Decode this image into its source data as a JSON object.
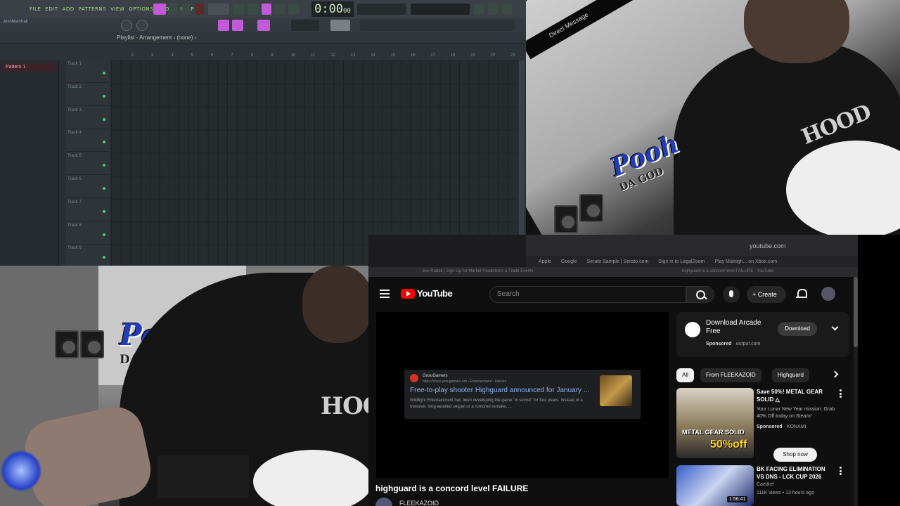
{
  "fl": {
    "menu": [
      "FILE",
      "EDIT",
      "ADD",
      "PATTERNS",
      "VIEW",
      "OPTIONS",
      "TOOLS",
      "HELP"
    ],
    "time": "0:00",
    "time_small": "00",
    "user": "JoshMarshall",
    "playlist_title": "Playlist - Arrangement › (none) ›",
    "pattern": "Pattern 1",
    "tracks": [
      "Track 1",
      "Track 2",
      "Track 3",
      "Track 4",
      "Track 5",
      "Track 6",
      "Track 7",
      "Track 8",
      "Track 9"
    ],
    "ruler": [
      "2",
      "3",
      "4",
      "5",
      "6",
      "7",
      "8",
      "9",
      "10",
      "11",
      "12",
      "13",
      "14",
      "15",
      "16",
      "17",
      "18",
      "19",
      "20",
      "21"
    ]
  },
  "cam_top": {
    "dm_label": "Direct Message",
    "logo": "Pooh",
    "logo_sub": "DA GOD",
    "hoodie_text": "HOOD"
  },
  "cam_bottom": {
    "logo": "Pooh",
    "logo_sub": "DA GOD",
    "hoodie_text": "HOOD"
  },
  "browser": {
    "url": "youtube.com",
    "bookmarks": [
      "Apple",
      "Google",
      "Serato Sample | Serato.com",
      "Sign in to LegalZoom",
      "Play Midnigh... on Xbox.com"
    ],
    "tabs": [
      "Jive Rabbit | Sign Up for Market Predictions & Trade Events",
      "highguard is a concord level FAILURE - YouTube"
    ]
  },
  "youtube": {
    "logo": "YouTube",
    "search_placeholder": "Search",
    "create_label": "+ Create",
    "card": {
      "source": "GosuGamers",
      "source_url": "https://www.gosugamers.net › Entertainment › Articles",
      "title": "Free-to-play shooter Highguard announced for January ...",
      "desc": "Wildlight Entertainment has been developing the game \"in secret\" for four years. Instead of a massive, long-awaited sequel or a rumored remake, ..."
    },
    "video_title": "highguard is a concord level FAILURE",
    "channel": "FLEEKAZOID",
    "ad": {
      "title": "Download Arcade Free",
      "sponsored": "Sponsored",
      "domain": "output.com",
      "button": "Download"
    },
    "chips": [
      "All",
      "From FLEEKAZOID",
      "Highguard"
    ],
    "recs": [
      {
        "title": "Save 50%! METAL GEAR SOLID △",
        "desc": "Your Lunar New Year mission: Grab 40% Off today on Steam!",
        "sponsored": "Sponsored",
        "advertiser": "KONAMI",
        "button": "Shop now",
        "thumb_text": "METAL GEAR SOLID",
        "thumb_badge": "50%off"
      },
      {
        "title": "BK FACING ELIMINATION VS DNS - LCK CUP 2026",
        "channel": "Caedrel",
        "meta": "111K views • 13 hours ago",
        "duration": "1:56:41"
      }
    ]
  },
  "colors": {
    "fl_green": "#a7d58a",
    "fl_accent": "#c05ad6",
    "yt_red": "#ff0000",
    "link_blue": "#8ab4f8"
  }
}
